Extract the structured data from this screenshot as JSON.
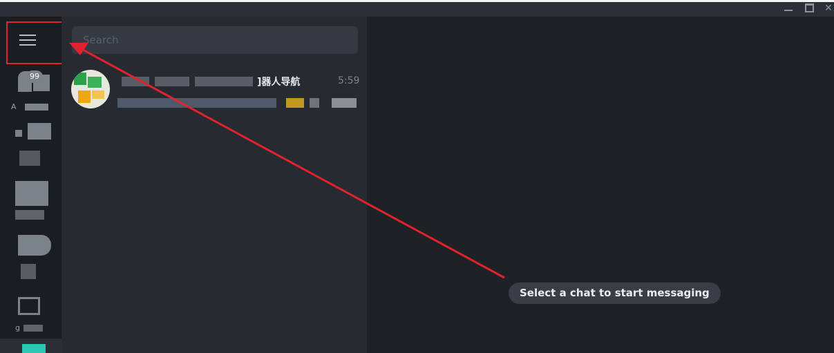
{
  "window": {
    "minimize_icon": "minimize-icon",
    "maximize_icon": "maximize-icon",
    "close_label": "✕"
  },
  "sidebar": {
    "menu_icon": "hamburger-menu-icon",
    "unread_badge": "99",
    "folders": [
      {
        "label": "A"
      },
      {
        "label": ""
      },
      {
        "label": ""
      },
      {
        "label": ""
      },
      {
        "label": "g"
      }
    ]
  },
  "search": {
    "placeholder": "Search"
  },
  "chats": [
    {
      "title_visible": "]器人导航",
      "time": "5:59"
    }
  ],
  "main": {
    "empty_state": "Select a chat to start messaging"
  },
  "annotation": {
    "color": "#e0232c"
  }
}
